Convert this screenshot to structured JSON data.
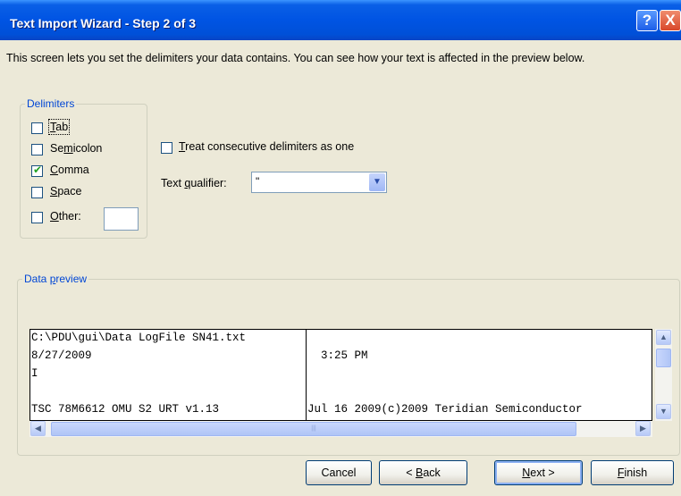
{
  "window": {
    "title": "Text Import Wizard - Step 2 of 3",
    "help_label": "?",
    "close_label": "X"
  },
  "description": "This screen lets you set the delimiters your data contains.  You can see how your text is affected in the preview below.",
  "delimiters": {
    "legend": "Delimiters",
    "items": [
      {
        "label": "Tab",
        "mnemonic": "T",
        "checked": false
      },
      {
        "label": "Semicolon",
        "mnemonic": "m",
        "checked": false
      },
      {
        "label": "Comma",
        "mnemonic": "C",
        "checked": true
      },
      {
        "label": "Space",
        "mnemonic": "S",
        "checked": false
      },
      {
        "label": "Other:",
        "mnemonic": "O",
        "checked": false
      }
    ],
    "other_value": ""
  },
  "consecutive": {
    "label": "Treat consecutive delimiters as one",
    "checked": false
  },
  "text_qualifier": {
    "label": "Text qualifier:",
    "value": "\""
  },
  "preview": {
    "legend": "Data preview",
    "rows": [
      [
        "C:\\PDU\\gui\\Data LogFile SN41.txt",
        ""
      ],
      [
        "8/27/2009",
        "  3:25 PM"
      ],
      [
        "I",
        ""
      ],
      [
        "",
        ""
      ],
      [
        "TSC 78M6612 OMU S2 URT v1.13",
        "Jul 16 2009(c)2009 Teridian Semiconductor"
      ]
    ]
  },
  "buttons": {
    "cancel": "Cancel",
    "back": "< Back",
    "next": "Next >",
    "finish": "Finish"
  }
}
